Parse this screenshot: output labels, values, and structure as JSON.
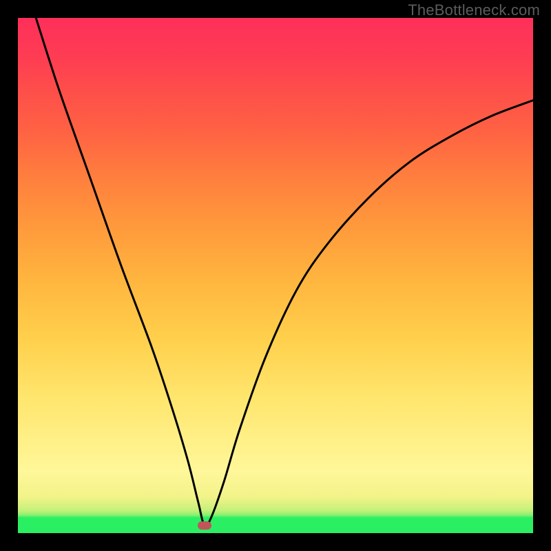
{
  "watermark": "TheBottleneck.com",
  "gradient": {
    "top_color": "#fe2f5b",
    "mid_color": "#ffe04a",
    "bottom_color": "#2aef62"
  },
  "curve": {
    "stroke": "#000000",
    "stroke_width": 3
  },
  "marker": {
    "color": "#c0555a",
    "x_frac": 0.362,
    "y_frac": 0.985
  },
  "chart_data": {
    "type": "line",
    "title": "",
    "xlabel": "",
    "ylabel": "",
    "xlim": [
      0,
      100
    ],
    "ylim": [
      0,
      100
    ],
    "series": [
      {
        "name": "bottleneck-curve",
        "x": [
          3.5,
          8,
          14,
          20,
          26,
          30,
          33,
          35,
          36.2,
          37.5,
          40,
          43,
          48,
          54,
          60,
          68,
          76,
          84,
          92,
          100
        ],
        "y": [
          100,
          86,
          69,
          52,
          36,
          24,
          14,
          6,
          1.5,
          3,
          10,
          20,
          34,
          47,
          56,
          65,
          72,
          77,
          81,
          84
        ]
      }
    ],
    "marker_point": {
      "x": 36.2,
      "y": 1.5
    },
    "notes": "V-shaped curve over a red-yellow-green vertical gradient; minimum marked by a small red lozenge near x≈36% just above baseline."
  }
}
